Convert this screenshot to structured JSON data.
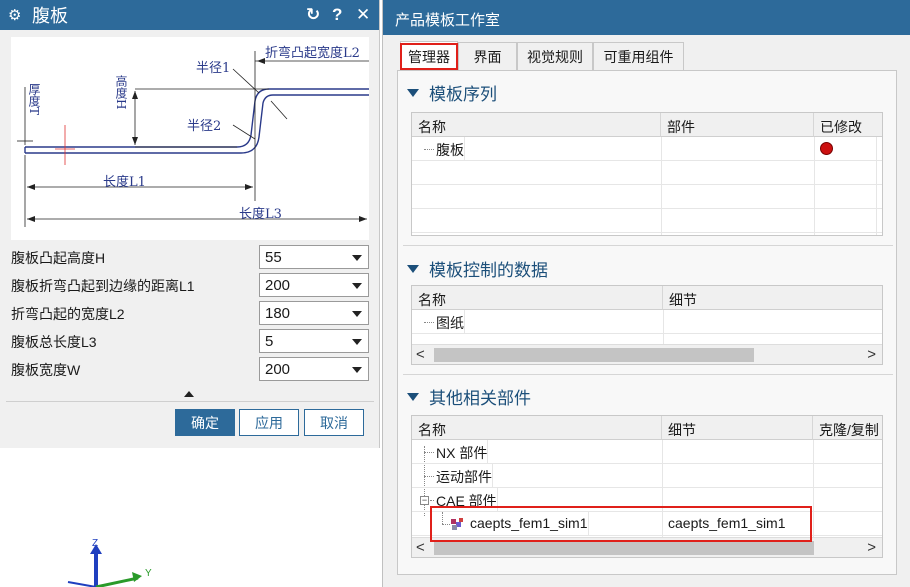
{
  "dialog": {
    "title": "腹板",
    "reset_glyph": "↻",
    "help_glyph": "?",
    "close_glyph": "✕",
    "diagram_labels": {
      "bend_width": "折弯凸起宽度L2",
      "radius1": "半径1",
      "radius2": "半径2",
      "height": "高度H",
      "thickness": "厚度T",
      "length1": "长度L1",
      "length3": "长度L3"
    },
    "params": [
      {
        "label": "腹板凸起高度H",
        "value": "55"
      },
      {
        "label": "腹板折弯凸起到边缘的距离L1",
        "value": "200"
      },
      {
        "label": "折弯凸起的宽度L2",
        "value": "180"
      },
      {
        "label": "腹板总长度L3",
        "value": "5"
      },
      {
        "label": "腹板宽度W",
        "value": "200"
      }
    ],
    "ok_label": "确定",
    "apply_label": "应用",
    "cancel_label": "取消"
  },
  "viewport": {
    "axis_z": "Z",
    "axis_y": "Y"
  },
  "panel": {
    "title": "产品模板工作室",
    "tabs": [
      "管理器",
      "界面",
      "视觉规则",
      "可重用组件"
    ],
    "active_tab": "管理器",
    "sections": {
      "sequence": {
        "title": "模板序列",
        "columns": [
          "名称",
          "部件",
          "已修改"
        ],
        "rows": [
          {
            "name": "腹板",
            "part": "",
            "modified": "yes"
          }
        ]
      },
      "controlled": {
        "title": "模板控制的数据",
        "columns": [
          "名称",
          "细节"
        ],
        "rows": [
          {
            "name": "图纸",
            "detail": ""
          }
        ]
      },
      "related": {
        "title": "其他相关部件",
        "columns": [
          "名称",
          "细节",
          "克隆/复制"
        ],
        "rows": [
          {
            "name": "NX 部件",
            "detail": ""
          },
          {
            "name": "运动部件",
            "detail": ""
          },
          {
            "name": "CAE 部件",
            "detail": "",
            "expander": "−"
          },
          {
            "name": "caepts_fem1_sim1",
            "detail": "caepts_fem1_sim1"
          }
        ]
      }
    },
    "scroll_left": "<",
    "scroll_right": ">"
  },
  "colors": {
    "title_bar": "#2d6a9a",
    "section_text": "#1c4f7a",
    "highlight": "#e0201a",
    "modified_dot": "#cc1010"
  }
}
